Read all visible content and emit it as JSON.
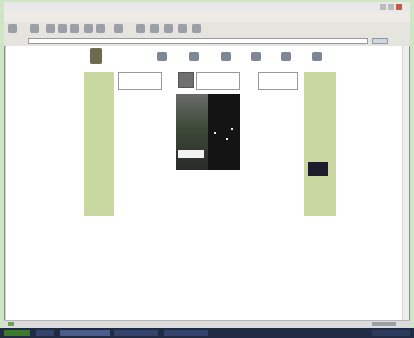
{
  "browser": {
    "title": "",
    "menu": [
      "",
      "",
      "",
      "",
      "",
      "",
      ""
    ],
    "address": "",
    "go": ""
  },
  "site": {
    "logo_text": "",
    "top_links": "",
    "nav": [
      "",
      "",
      "",
      "",
      "",
      ""
    ],
    "left_nav": [
      "",
      "",
      "",
      "",
      "",
      "",
      "",
      ""
    ],
    "right_nav": [
      "",
      "",
      "",
      "",
      "",
      "",
      "",
      "",
      ""
    ],
    "box_left": "",
    "box_center": "",
    "box_right": "",
    "center_texts": [
      "",
      "",
      "",
      "",
      "",
      "",
      "",
      "",
      ""
    ]
  }
}
